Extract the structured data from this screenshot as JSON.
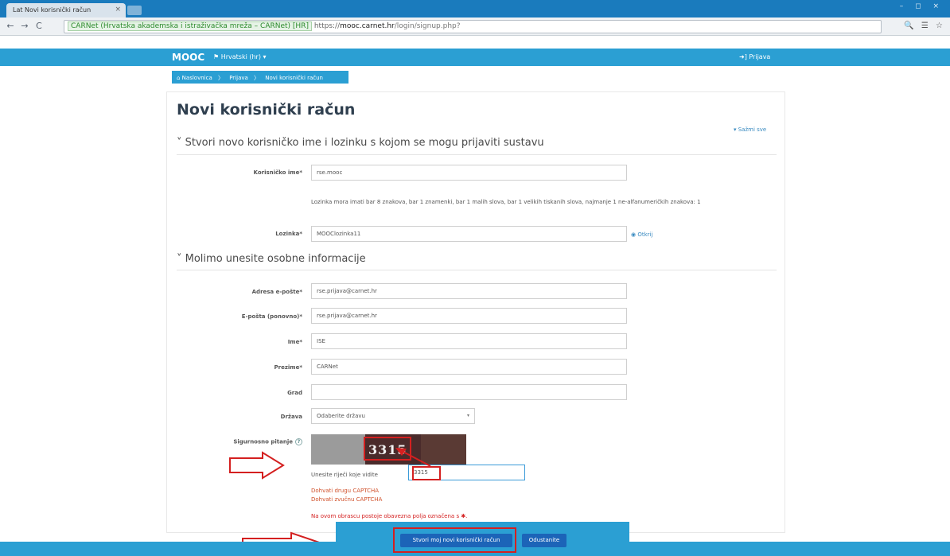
{
  "browser": {
    "tab_title": "Lat Novi korisnički račun",
    "tab_close": "×",
    "window_controls": "–  ◻  ×",
    "nav": {
      "back": "←",
      "forward": "→",
      "reload": "C"
    },
    "url": {
      "secure_label": "CARNet (Hrvatska akademska i istraživačka mreža – CARNet) [HR]",
      "scheme": "https://",
      "host": "mooc.carnet.hr",
      "path": "/login/signup.php?"
    },
    "toolbar_icons": "🔍 ☰ ☆"
  },
  "site": {
    "brand": "MOOC",
    "language_menu": "⚑ Hrvatski (hr) ▾",
    "login_link": "➜] Prijava"
  },
  "breadcrumb": [
    "⌂ Naslovnica",
    "Prijava",
    "Novi korisnički račun"
  ],
  "page": {
    "title": "Novi korisnički račun",
    "collapse_all": "▾ Sažmi sve"
  },
  "sections": {
    "account": "Stvori novo korisničko ime i lozinku s kojom se mogu prijaviti sustavu",
    "personal": "Molimo unesite osobne informacije"
  },
  "fields": {
    "username": {
      "label": "Korisničko ime*",
      "value": "rse.mooc"
    },
    "password_rules": "Lozinka mora imati bar 8 znakova, bar 1 znamenki, bar 1 malih slova, bar 1 velikih tiskanih slova, najmanje 1 ne-alfanumeričkih znakova: 1",
    "password": {
      "label": "Lozinka*",
      "value": "MOOClozinka11",
      "reveal": "◉ Otkrij"
    },
    "email": {
      "label": "Adresa e-pošte*",
      "value": "rse.prijava@carnet.hr"
    },
    "email_again": {
      "label": "E-pošta (ponovno)*",
      "value": "rse.prijava@carnet.hr"
    },
    "firstname": {
      "label": "Ime*",
      "value": "ISE"
    },
    "lastname": {
      "label": "Prezime*",
      "value": "CARNet"
    },
    "city": {
      "label": "Grad",
      "value": ""
    },
    "country": {
      "label": "Država",
      "value": "Odaberite državu",
      "caret": "▾"
    }
  },
  "captcha": {
    "label": "Sigurnosno pitanje",
    "help": "?",
    "image_text": "3315",
    "input_label": "Unesite riječi koje vidite",
    "answer": "3315",
    "link_another": "Dohvati drugu CAPTCHA",
    "link_audio": "Dohvati zvučnu CAPTCHA"
  },
  "required_note": "Na ovom obrascu postoje obavezna polja označena s ✱.",
  "buttons": {
    "create": "Stvori moj novi korisnički račun",
    "cancel": "Odustanite"
  },
  "colors": {
    "brand_blue": "#2b9fd3",
    "button_blue": "#1c64b8",
    "annotation_red": "#d42020"
  }
}
